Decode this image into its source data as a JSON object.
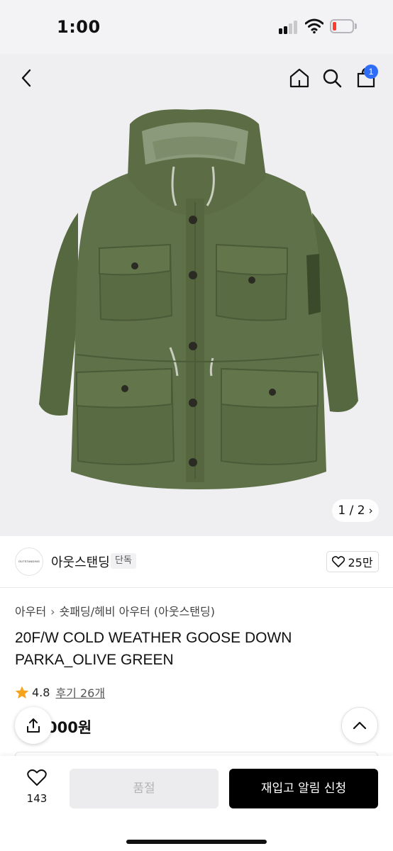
{
  "status": {
    "time": "1:00"
  },
  "nav": {
    "cart_count": "1"
  },
  "hero": {
    "counter": "1 / 2"
  },
  "brand": {
    "logo_text": "OUTSTANDING",
    "name": "아웃스탠딩",
    "exclusive_tag": "단독",
    "likes": "25만"
  },
  "product": {
    "breadcrumb": [
      "아우터",
      "숏패딩/헤비 아우터 (아웃스탠딩)"
    ],
    "title": "20F/W COLD WEATHER GOOSE DOWN PARKA_OLIVE GREEN",
    "rating": "4.8",
    "reviews": "후기 26개",
    "price": "000원"
  },
  "bottom": {
    "wish_count": "143",
    "soldout_label": "품절",
    "restock_label": "재입고 알림 신청"
  },
  "colors": {
    "accent_badge": "#2f6df6",
    "star": "#f7a21b",
    "jacket": "#5f7148",
    "primary_button": "#000000"
  },
  "icons": [
    "back-icon",
    "home-icon",
    "search-icon",
    "bag-icon",
    "heart-icon",
    "star-icon",
    "share-icon",
    "chevron-up-icon",
    "chevron-right-icon"
  ]
}
